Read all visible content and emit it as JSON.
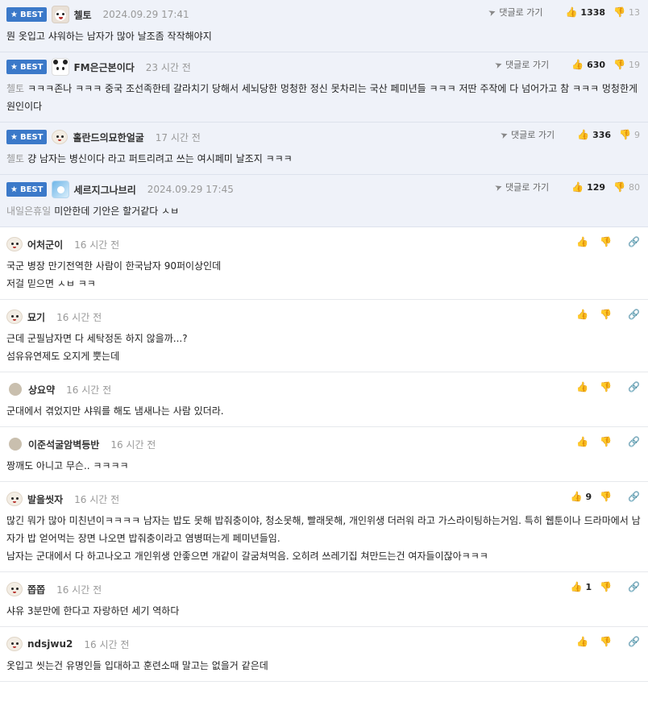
{
  "reply_label": "댓글로 가기",
  "best_label": "BEST",
  "best": [
    {
      "nick": "첼토",
      "time": "2024.09.29 17:41",
      "up": "1338",
      "down": "13",
      "ref": "",
      "text": "뭔 옷입고 샤워하는 남자가 많아 날조좀 작작해야지",
      "avatar": "dog"
    },
    {
      "nick": "FM은근본이다",
      "time": "23 시간 전",
      "up": "630",
      "down": "19",
      "ref": "첼토",
      "text": "ㅋㅋㅋ존나 ㅋㅋㅋ 중국 조선족한테 갈라치기 당해서 세뇌당한 멍청한 정신 못차리는 국산 페미년들 ㅋㅋㅋ 저딴 주작에 다 넘어가고 참 ㅋㅋㅋ 멍청한게 원인이다",
      "avatar": "panda"
    },
    {
      "nick": "홀란드의묘한얼굴",
      "time": "17 시간 전",
      "up": "336",
      "down": "9",
      "ref": "첼토",
      "text": "걍 남자는 병신이다 라고 퍼트리려고 쓰는 여시페미 날조지 ㅋㅋㅋ",
      "avatar": "dog-small"
    },
    {
      "nick": "세르지그나브리",
      "time": "2024.09.29 17:45",
      "up": "129",
      "down": "80",
      "ref": "내일은휴일",
      "text": "미안한데 기안은 할거같다 ㅅㅂ",
      "avatar": "blue"
    }
  ],
  "comments": [
    {
      "nick": "어처군이",
      "time": "16 시간 전",
      "up": "",
      "lines": [
        "국군 병장 만기전역한 사람이 한국남자 90퍼이상인데",
        "저걸 믿으면 ㅅㅂ ㅋㅋ"
      ],
      "avatar": "dog-small"
    },
    {
      "nick": "묘기",
      "time": "16 시간 전",
      "up": "",
      "lines": [
        "근데 군필남자면 다 세탁정돈 하지 않을까...?",
        "섬유유연제도 오지게 뿟는데"
      ],
      "avatar": "dog-small"
    },
    {
      "nick": "상요약",
      "time": "16 시간 전",
      "up": "",
      "lines": [
        "군대에서 겪었지만 샤워를 해도 냄새나는 사람 있더라."
      ],
      "avatar": "dot"
    },
    {
      "nick": "이준석굴암벽등반",
      "time": "16 시간 전",
      "up": "",
      "lines": [
        "짱깨도 아니고 무슨.. ㅋㅋㅋㅋ"
      ],
      "avatar": "dot"
    },
    {
      "nick": "발을씻자",
      "time": "16 시간 전",
      "up": "9",
      "lines": [
        "많긴 뭐가 많아 미친년이ㅋㅋㅋㅋ 남자는 밥도 못해 밥줘충이야, 청소못해, 빨래못해, 개인위생 더러워 라고 가스라이팅하는거임. 특히 웹툰이나 드라마에서 남자가 밥 얻어먹는 장면 나오면 밥줘충이라고 염병떠는게 페미년들임.",
        "남자는 군대에서 다 하고나오고 개인위생 안좋으면 개같이 갈굼쳐먹음. 오히려 쓰레기집 쳐만드는건 여자들이잖아ㅋㅋㅋ"
      ],
      "avatar": "dog-small"
    },
    {
      "nick": "쫍쫍",
      "time": "16 시간 전",
      "up": "1",
      "lines": [
        "샤유 3분만에 한다고 자랑하던 세기 역하다"
      ],
      "avatar": "dog-small"
    },
    {
      "nick": "ndsjwu2",
      "time": "16 시간 전",
      "up": "",
      "lines": [
        "옷입고 씻는건 유명인들 입대하고 훈련소때 말고는 없을거 같은데"
      ],
      "avatar": "dog-small"
    }
  ]
}
